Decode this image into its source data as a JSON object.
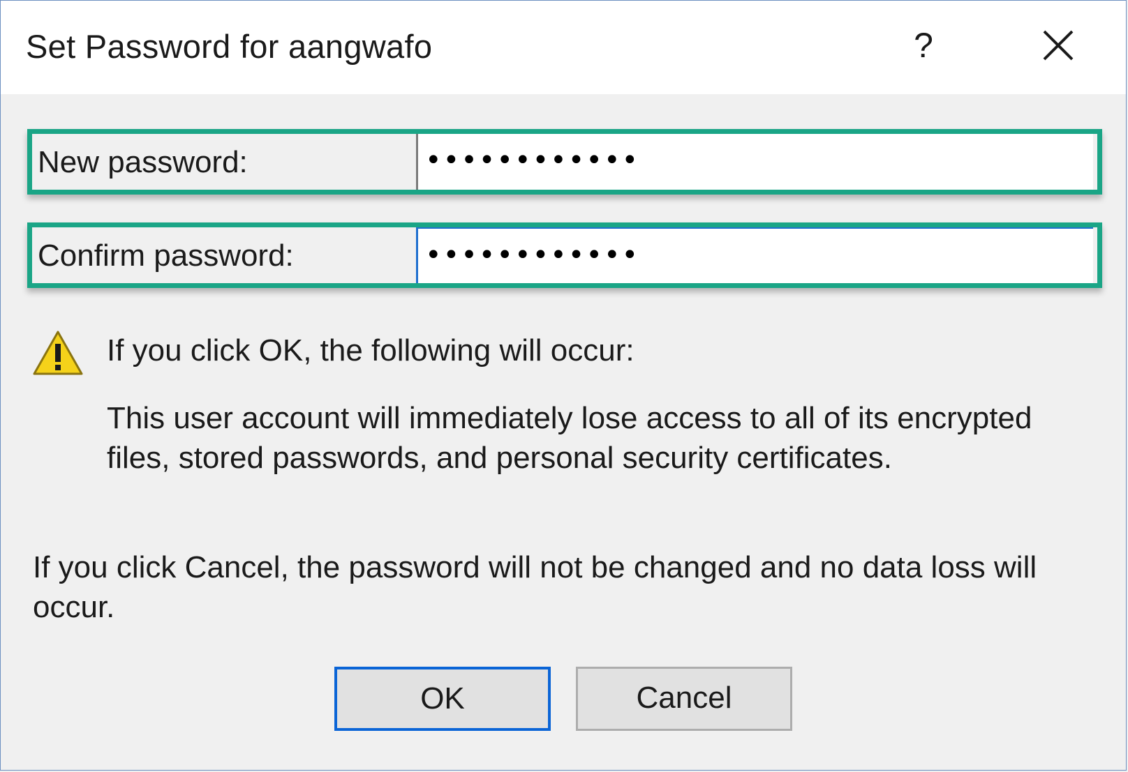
{
  "dialog": {
    "title": "Set Password for aangwafo",
    "help_label": "?"
  },
  "fields": {
    "new_password": {
      "label": "New password:",
      "value": "••••••••••••"
    },
    "confirm_password": {
      "label": "Confirm password:",
      "value": "••••••••••••"
    }
  },
  "warning": {
    "icon": "warning-icon",
    "heading": "If you click OK, the following will occur:",
    "body": "This user account will immediately lose access to all of its encrypted files, stored passwords, and personal security certificates."
  },
  "cancel_note": "If you click Cancel, the password will not be changed and no data loss will occur.",
  "buttons": {
    "ok": "OK",
    "cancel": "Cancel"
  },
  "colors": {
    "highlight": "#1aa586",
    "focus": "#0a64d6",
    "warning_yellow": "#f5d21a"
  }
}
